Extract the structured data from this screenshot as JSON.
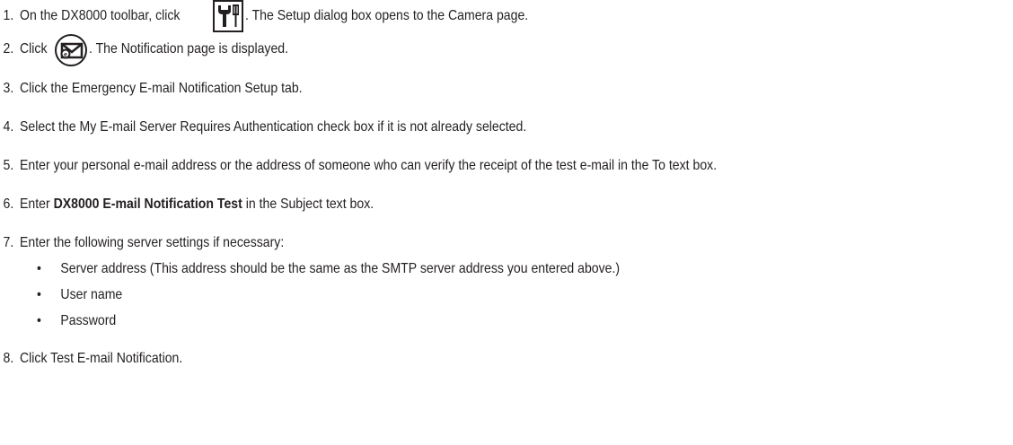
{
  "steps": [
    {
      "number": "1.",
      "before": "On the DX8000 toolbar, click",
      "after": ". The Setup dialog box opens to the Camera page.",
      "icon": "setup-tools-icon"
    },
    {
      "number": "2.",
      "before": "Click",
      "after": ". The Notification page is displayed.",
      "icon": "email-notification-icon"
    },
    {
      "number": "3.",
      "text": "Click the Emergency E-mail Notification Setup tab."
    },
    {
      "number": "4.",
      "text": "Select the My E-mail Server Requires Authentication check box if it is not already selected."
    },
    {
      "number": "5.",
      "text": "Enter your personal e-mail address or the address of someone who can verify the receipt of the test e-mail in the To text box."
    },
    {
      "number": "6.",
      "before": "Enter",
      "bold": "DX8000 E-mail Notification Test",
      "after": "in the Subject text box."
    },
    {
      "number": "7.",
      "text": "Enter the following server settings if necessary:"
    },
    {
      "number": "8.",
      "text": "Click Test E-mail Notification."
    }
  ],
  "bullet_glyph": "•",
  "server_settings": [
    "Server address (This address should be the same as the SMTP server address you entered above.)",
    "User name",
    "Password"
  ]
}
